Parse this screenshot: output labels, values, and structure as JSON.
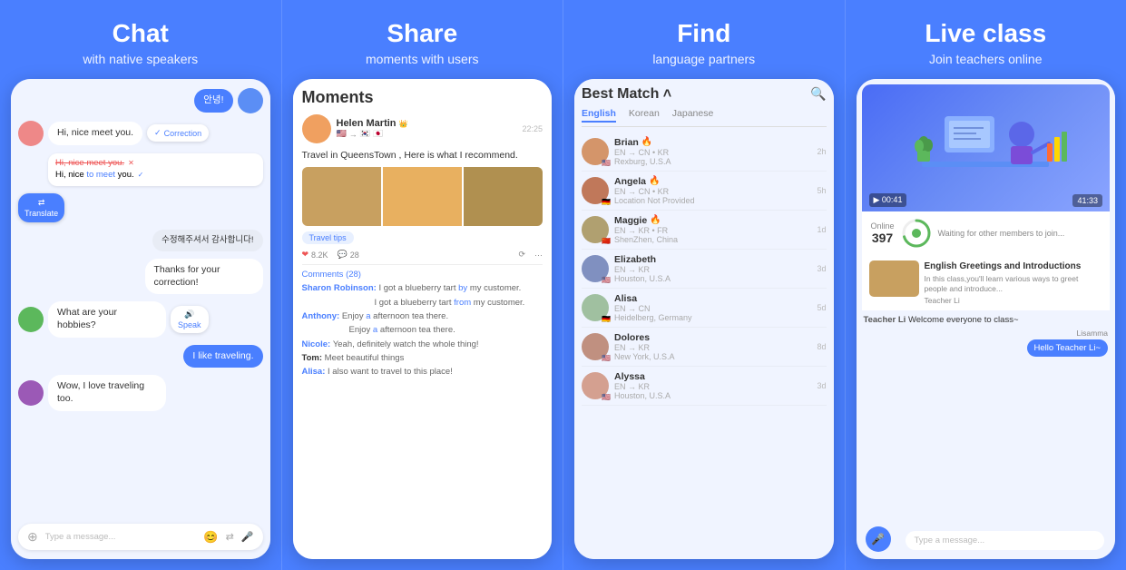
{
  "panels": [
    {
      "id": "chat",
      "title": "Chat",
      "subtitle": "with native speakers"
    },
    {
      "id": "share",
      "title": "Share",
      "subtitle": "moments with users"
    },
    {
      "id": "find",
      "title": "Find",
      "subtitle": "language partners"
    },
    {
      "id": "live",
      "title": "Live class",
      "subtitle": "Join teachers online"
    }
  ],
  "chat": {
    "messages": [
      {
        "type": "right",
        "text": "안녕!",
        "avatar": "blue"
      },
      {
        "type": "left",
        "text": "Hi, nice meet you.",
        "avatar": "pink"
      },
      {
        "type": "correction_badge",
        "text": "Correction"
      },
      {
        "type": "correction_block",
        "wrong": "Hi, nice meet you.",
        "right": "Hi, nice to meet you."
      },
      {
        "type": "left_translate",
        "text": "Translate"
      },
      {
        "type": "right",
        "text": "수정해주셔서 감사합니다!",
        "avatar": ""
      },
      {
        "type": "right",
        "text": "Thanks for your correction!",
        "avatar": ""
      },
      {
        "type": "left",
        "text": "What are your hobbies?",
        "avatar": "green"
      },
      {
        "type": "right_speak",
        "text": "Speak"
      },
      {
        "type": "right",
        "text": "I like traveling.",
        "avatar": ""
      }
    ],
    "last_msg": {
      "avatar": "purple",
      "text": "Wow, I love traveling too."
    },
    "input_placeholder": "Type a message..."
  },
  "share": {
    "title": "Moments",
    "post": {
      "author": "Helen Martin",
      "flags": [
        "EN",
        "KR",
        "JP"
      ],
      "time": "22:25",
      "text": "Travel in QueensTown , Here is what I recommend.",
      "tag": "Travel tips",
      "likes": "8.2K",
      "comments": "28"
    },
    "comments_label": "Comments (28)",
    "comments": [
      {
        "author": "Sharon Robinson:",
        "lines": [
          {
            "text": "I got a blueberry tart ",
            "highlight": "by",
            "rest": " my customer."
          },
          {
            "text": "I got a blueberry tart ",
            "highlight": "from",
            "rest": " my customer."
          }
        ]
      },
      {
        "author": "Anthony:",
        "lines": [
          {
            "text": "Enjoy ",
            "highlight": "a",
            "rest": " afternoon tea there."
          },
          {
            "text": "Enjoy ",
            "highlight": "a",
            "rest": " afternoon tea there."
          }
        ]
      },
      {
        "author": "Nicole:",
        "text": "Yeah, definitely watch the whole thing!"
      },
      {
        "author": "Tom:",
        "text": "Meet beautiful things"
      },
      {
        "author": "Alisa:",
        "text": "I also want to travel to this place!"
      }
    ]
  },
  "find": {
    "title": "Best Match",
    "tabs": [
      "English",
      "Korean",
      "Japanese"
    ],
    "active_tab": 0,
    "users": [
      {
        "name": "Brian",
        "langs": "EN → CN • KR",
        "location": "Rexburg, U.S.A",
        "time": "2h",
        "avatar": "brian"
      },
      {
        "name": "Angela",
        "langs": "EN → CN • KR",
        "location": "Location Not Provided",
        "time": "5h",
        "avatar": "angela"
      },
      {
        "name": "Maggie",
        "langs": "EN → KR • FR",
        "location": "ShenZhen, China",
        "time": "1d",
        "avatar": "maggie"
      },
      {
        "name": "Elizabeth",
        "langs": "EN → KR",
        "location": "Houston, U.S.A",
        "time": "3d",
        "avatar": "elizabeth"
      },
      {
        "name": "Alisa",
        "langs": "EN → CN",
        "location": "Heidelberg, Germany",
        "time": "5d",
        "avatar": "alisa"
      },
      {
        "name": "Dolores",
        "langs": "EN → KR",
        "location": "New York, U.S.A",
        "time": "8d",
        "avatar": "dolores"
      },
      {
        "name": "Alyssa",
        "langs": "EN → KR",
        "location": "Houston, U.S.A",
        "time": "3d",
        "avatar": "alyssa"
      }
    ]
  },
  "live": {
    "title": "Live class",
    "subtitle": "Join teachers online",
    "online_count": "397",
    "waiting_text": "Waiting for other members to join...",
    "class_title": "English Greetings and Introductions",
    "class_desc": "In this class,you'll learn various ways to greet people and introduce...",
    "class_teacher": "Teacher Li",
    "chat_messages": [
      {
        "sender": "Teacher Li",
        "text": "Welcome everyone to class~"
      },
      {
        "sender": "Lisamma",
        "text": "Hello Teacher Li~",
        "type": "self"
      }
    ],
    "input_placeholder": "Type a message...",
    "play_time": "00:41",
    "total_time": "41:33"
  }
}
